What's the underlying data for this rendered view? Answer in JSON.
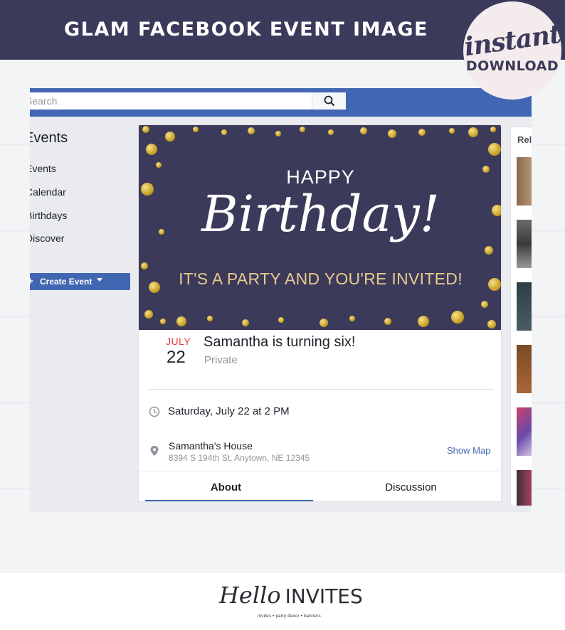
{
  "banner": {
    "title": "GLAM FACEBOOK EVENT IMAGE"
  },
  "badge": {
    "script": "instant",
    "word": "DOWNLOAD"
  },
  "fb": {
    "search_placeholder": "Search",
    "sidebar": {
      "title": "Events",
      "items": [
        "Events",
        "Calendar",
        "Birthdays",
        "Discover"
      ],
      "create_label": "Create Event",
      "create_plus": "+"
    },
    "cover": {
      "line1": "HAPPY",
      "line2": "Birthday!",
      "line3": "IT'S A PARTY AND YOU'RE INVITED!"
    },
    "event": {
      "month": "JULY",
      "day": "22",
      "title": "Samantha is turning six!",
      "privacy": "Private",
      "time": "Saturday, July 22 at 2 PM",
      "place_name": "Samantha's House",
      "place_address": "8394 S 194th St, Anytown, NE 12345",
      "show_map": "Show Map"
    },
    "tabs": {
      "about": "About",
      "discussion": "Discussion"
    },
    "right_column": {
      "heading": "Related"
    }
  },
  "footer": {
    "logo_script": "Hello",
    "logo_word": "INVITES",
    "tagline": "invites • party decor • banners"
  },
  "colors": {
    "navy": "#3b3a5a",
    "facebook_blue": "#4267b2",
    "gold": "#e8c98e",
    "month_red": "#e2413a"
  }
}
